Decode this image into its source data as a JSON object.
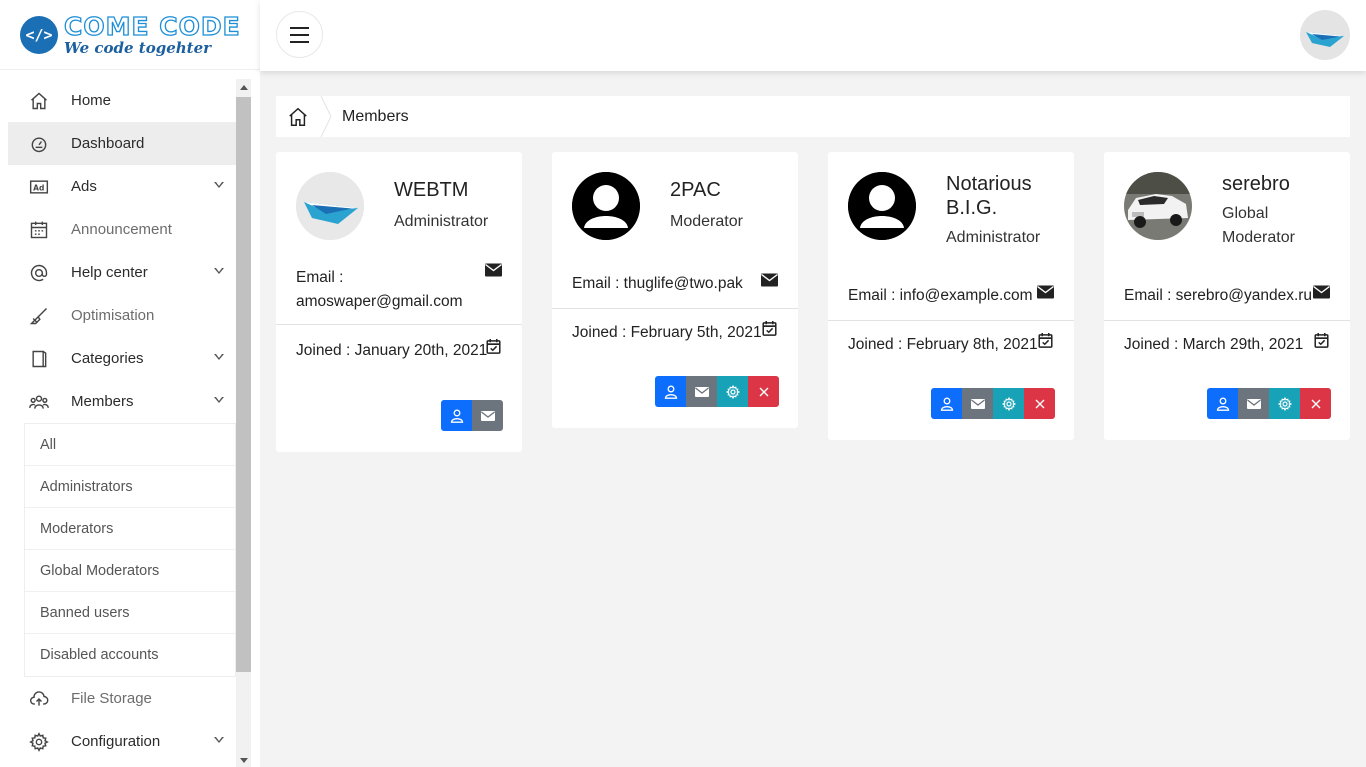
{
  "brand": {
    "title": "COME CODE",
    "tagline": "We code togehter"
  },
  "sidebar": {
    "items": [
      {
        "label": "Home",
        "icon": "home-icon"
      },
      {
        "label": "Dashboard",
        "icon": "dashboard-icon",
        "active": true
      },
      {
        "label": "Ads",
        "icon": "ad-icon",
        "has_submenu": true
      },
      {
        "label": "Announcement",
        "icon": "calendar-icon"
      },
      {
        "label": "Help center",
        "icon": "at-icon",
        "has_submenu": true
      },
      {
        "label": "Optimisation",
        "icon": "brush-icon"
      },
      {
        "label": "Categories",
        "icon": "book-icon",
        "has_submenu": true
      },
      {
        "label": "Members",
        "icon": "users-icon",
        "has_submenu": true,
        "expanded": true
      },
      {
        "label": "File Storage",
        "icon": "cloud-upload-icon"
      },
      {
        "label": "Configuration",
        "icon": "gear-icon",
        "has_submenu": true
      }
    ],
    "members_submenu": [
      "All",
      "Administrators",
      "Moderators",
      "Global Moderators",
      "Banned users",
      "Disabled accounts"
    ]
  },
  "breadcrumb": {
    "current": "Members"
  },
  "members": [
    {
      "name": "WEBTM",
      "role": "Administrator",
      "email": "Email : amoswaper@gmail.com",
      "joined": "Joined : January 20th, 2021",
      "avatar": "paper-plane-logo"
    },
    {
      "name": "2PAC",
      "role": "Moderator",
      "email": "Email : thuglife@two.pak",
      "joined": "Joined : February 5th, 2021",
      "avatar": "default-user"
    },
    {
      "name": "Notarious B.I.G.",
      "role": "Administrator",
      "email": "Email : info@example.com",
      "joined": "Joined : February 8th, 2021",
      "avatar": "default-user"
    },
    {
      "name": "serebro",
      "role": "Global Moderator",
      "email": "Email : serebro@yandex.ru",
      "joined": "Joined : March 29th, 2021",
      "avatar": "car-photo"
    }
  ],
  "colors": {
    "primary": "#0d6efd",
    "secondary": "#6c757d",
    "info": "#17a2b8",
    "danger": "#dc3545",
    "brand": "#1b6fb5"
  }
}
